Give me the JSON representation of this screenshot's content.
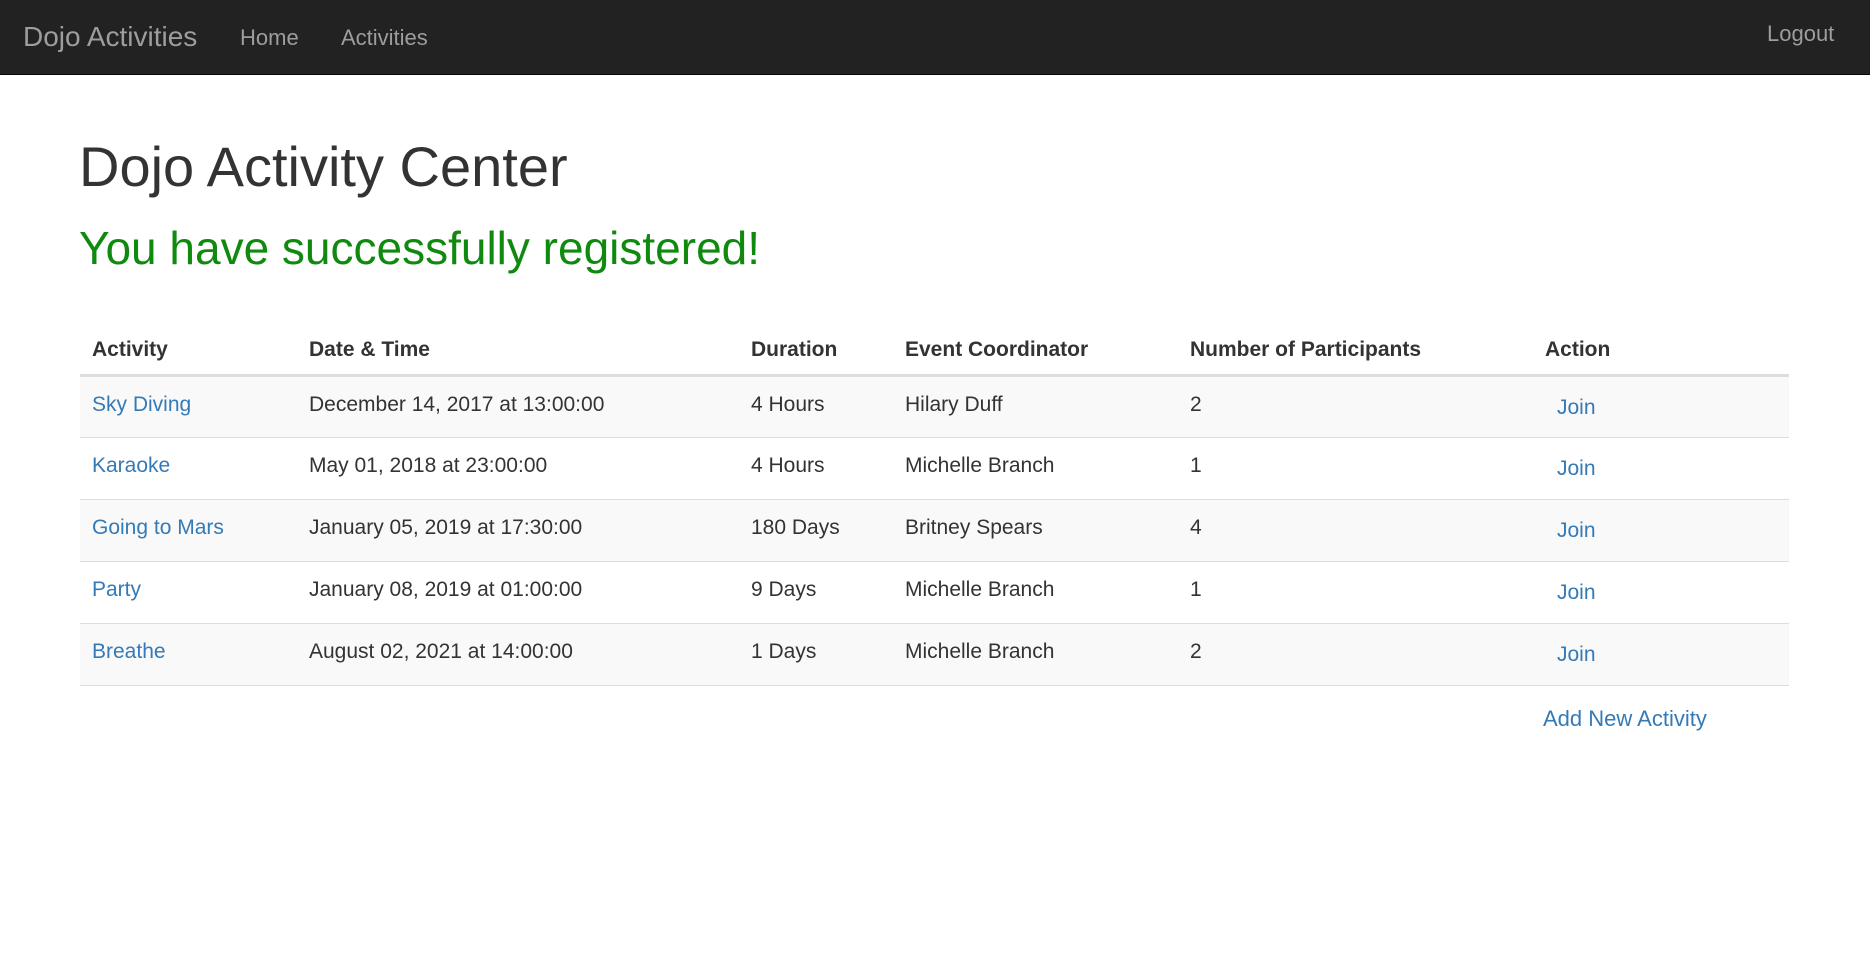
{
  "navbar": {
    "brand": "Dojo Activities",
    "links": [
      {
        "label": "Home"
      },
      {
        "label": "Activities"
      }
    ],
    "logout": "Logout"
  },
  "page": {
    "title": "Dojo Activity Center",
    "flash_message": "You have successfully registered!"
  },
  "table": {
    "headers": [
      "Activity",
      "Date & Time",
      "Duration",
      "Event Coordinator",
      "Number of Participants",
      "Action"
    ],
    "rows": [
      {
        "activity": "Sky Diving",
        "datetime": "December 14, 2017 at 13:00:00",
        "duration": "4 Hours",
        "coordinator": "Hilary Duff",
        "participants": "2",
        "action": "Join"
      },
      {
        "activity": "Karaoke",
        "datetime": "May 01, 2018 at 23:00:00",
        "duration": "4 Hours",
        "coordinator": "Michelle Branch",
        "participants": "1",
        "action": "Join"
      },
      {
        "activity": "Going to Mars",
        "datetime": "January 05, 2019 at 17:30:00",
        "duration": "180 Days",
        "coordinator": "Britney Spears",
        "participants": "4",
        "action": "Join"
      },
      {
        "activity": "Party",
        "datetime": "January 08, 2019 at 01:00:00",
        "duration": "9 Days",
        "coordinator": "Michelle Branch",
        "participants": "1",
        "action": "Join"
      },
      {
        "activity": "Breathe",
        "datetime": "August 02, 2021 at 14:00:00",
        "duration": "1 Days",
        "coordinator": "Michelle Branch",
        "participants": "2",
        "action": "Join"
      }
    ]
  },
  "add_new_activity": "Add New Activity",
  "colors": {
    "navbar_bg": "#222222",
    "nav_text": "#9d9d9d",
    "link": "#337ab7",
    "success": "#0f8a0f",
    "stripe": "#f9f9f9"
  }
}
